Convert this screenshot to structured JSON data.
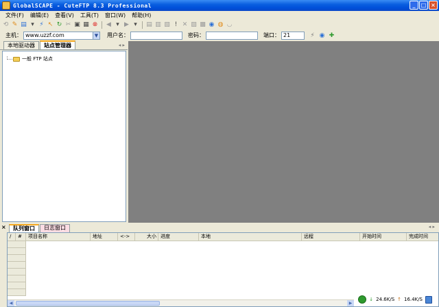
{
  "window": {
    "title": "GlobalSCAPE - CuteFTP 8.3 Professional",
    "buttons": [
      "_",
      "□",
      "×"
    ]
  },
  "menu": [
    "文件(F)",
    "编辑(E)",
    "查看(V)",
    "工具(T)",
    "窗口(W)",
    "帮助(H)"
  ],
  "toolbar": {
    "icons": [
      "connect-icon",
      "wizard-icon",
      "new-icon",
      "dropdown-arrow-icon",
      "disconnect-icon",
      "select-icon",
      "reconnect-icon",
      "stop-transfer-icon",
      "mark-icon",
      "site-manager-icon",
      "cancel-icon",
      "back-icon",
      "forward-icon",
      "upload-icon",
      "download-icon",
      "copy-icon",
      "exclamation-icon",
      "delete-icon",
      "edit-icon",
      "view-icon",
      "properties-icon",
      "help-icon",
      "close-icon"
    ]
  },
  "quick_connect": {
    "host_label": "主机：",
    "host_value": "www.uzzf.com",
    "user_label": "用户名：",
    "user_value": "",
    "pass_label": "密码：",
    "pass_value": "",
    "port_label": "端口：",
    "port_value": "21"
  },
  "left_panel": {
    "tabs": [
      "本地驱动器",
      "站点管理器"
    ],
    "active_tab": 1,
    "tree": [
      {
        "label": "一般 FTP 站点"
      }
    ]
  },
  "bottom_panel": {
    "close": "×",
    "tabs": [
      "队列窗口",
      "日志窗口"
    ],
    "active_tab": 0,
    "columns": [
      "/",
      "#",
      "项目名称",
      "地址",
      "<->",
      "大小",
      "进度",
      "本地",
      "远程",
      "开始时间",
      "完成时间"
    ],
    "rows": []
  },
  "status": {
    "download_speed": "24.6K/S",
    "upload_speed": "16.4K/S"
  },
  "colors": {
    "title_bar": "#0A5FE0",
    "workspace": "#808080",
    "chrome": "#ECE9D8",
    "active_tab_accent": "#F4A81F",
    "log_tab": "#FBDCE3"
  }
}
